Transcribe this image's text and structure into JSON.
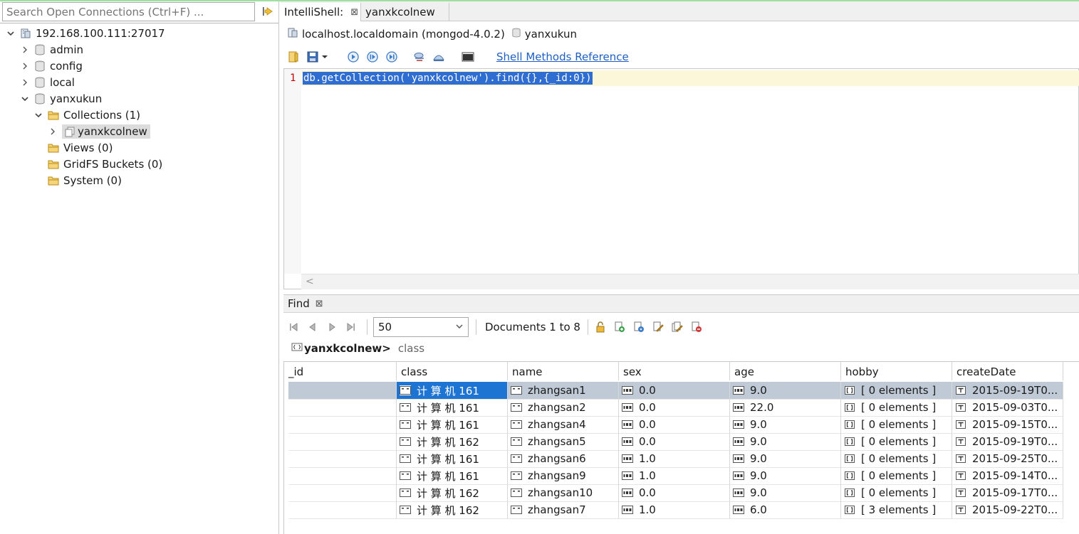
{
  "search": {
    "placeholder": "Search Open Connections (Ctrl+F) ..."
  },
  "tree": {
    "connection": "192.168.100.111:27017",
    "databases": [
      "admin",
      "config",
      "local",
      "yanxukun"
    ],
    "collections_folder": "Collections (1)",
    "collection": "yanxkcolnew",
    "views": "Views (0)",
    "gridfs": "GridFS Buckets (0)",
    "system": "System (0)"
  },
  "tabs": {
    "active": "IntelliShell:",
    "inactive": "yanxkcolnew"
  },
  "conn_info": {
    "host": "localhost.localdomain (mongod-4.0.2)",
    "db": "yanxukun"
  },
  "toolbar": {
    "shell_ref": "Shell Methods Reference"
  },
  "editor": {
    "line_number": "1",
    "code": "db.getCollection('yanxkcolnew').find({},{_id:0})"
  },
  "find": {
    "tab_label": "Find",
    "page_size": "50",
    "documents": "Documents 1 to 8",
    "breadcrumb_collection": "yanxkcolnew>",
    "breadcrumb_field": "class"
  },
  "table": {
    "columns": [
      "_id",
      "class",
      "name",
      "sex",
      "age",
      "hobby",
      "createDate"
    ],
    "rows": [
      [
        "",
        "计 算 机 161",
        "zhangsan1",
        "0.0",
        "9.0",
        "[ 0 elements ]",
        "2015-09-19T0..."
      ],
      [
        "",
        "计 算 机 161",
        "zhangsan2",
        "0.0",
        "22.0",
        "[ 0 elements ]",
        "2015-09-03T0..."
      ],
      [
        "",
        "计 算 机 161",
        "zhangsan4",
        "0.0",
        "9.0",
        "[ 0 elements ]",
        "2015-09-15T0..."
      ],
      [
        "",
        "计 算 机 162",
        "zhangsan5",
        "0.0",
        "9.0",
        "[ 0 elements ]",
        "2015-09-19T0..."
      ],
      [
        "",
        "计 算 机 161",
        "zhangsan6",
        "1.0",
        "9.0",
        "[ 0 elements ]",
        "2015-09-25T0..."
      ],
      [
        "",
        "计 算 机 161",
        "zhangsan9",
        "1.0",
        "9.0",
        "[ 0 elements ]",
        "2015-09-14T0..."
      ],
      [
        "",
        "计 算 机 162",
        "zhangsan10",
        "0.0",
        "9.0",
        "[ 0 elements ]",
        "2015-09-17T0..."
      ],
      [
        "",
        "计 算 机 162",
        "zhangsan7",
        "1.0",
        "6.0",
        "[ 3 elements ]",
        "2015-09-22T0..."
      ]
    ]
  },
  "colors": {
    "accent": "#1e74d2",
    "selected_row": "#bfcad6",
    "link": "#1f5fc4",
    "line_number": "#c00000"
  }
}
